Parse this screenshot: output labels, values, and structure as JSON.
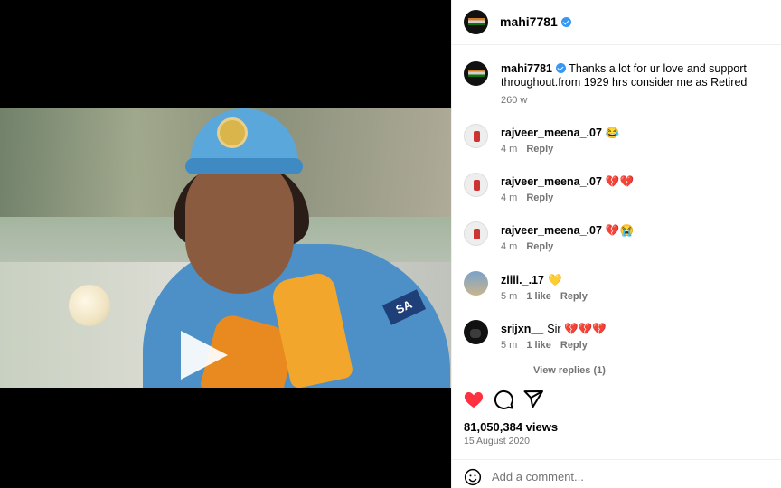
{
  "post": {
    "author": "mahi7781",
    "caption": "Thanks a lot for ur love and support throughout.from 1929 hrs consider me as Retired",
    "caption_age": "260 w",
    "views": "81,050,384 views",
    "date": "15 August 2020"
  },
  "comments": [
    {
      "username": "rajveer_meena_.07",
      "text": "😂",
      "age": "4 m",
      "likes": "",
      "reply": "Reply"
    },
    {
      "username": "rajveer_meena_.07",
      "text": "💔💔",
      "age": "4 m",
      "likes": "",
      "reply": "Reply"
    },
    {
      "username": "rajveer_meena_.07",
      "text": "💔😭",
      "age": "4 m",
      "likes": "",
      "reply": "Reply"
    },
    {
      "username": "ziiii._.17",
      "text": "💛",
      "age": "5 m",
      "likes": "1 like",
      "reply": "Reply"
    },
    {
      "username": "srijxn__",
      "text": "Sir 💔💔💔",
      "age": "5 m",
      "likes": "1 like",
      "reply": "Reply"
    }
  ],
  "view_replies": "View replies (1)",
  "add_comment": {
    "placeholder": "Add a comment..."
  },
  "media_text": {
    "jersey": "SA"
  },
  "colors": {
    "like": "#ff3040",
    "verified": "#3897f0",
    "secondary": "#737373"
  },
  "icons": [
    "play-icon",
    "mute-icon",
    "heart-icon",
    "comment-icon",
    "share-icon",
    "emoji-icon",
    "verified-icon"
  ]
}
